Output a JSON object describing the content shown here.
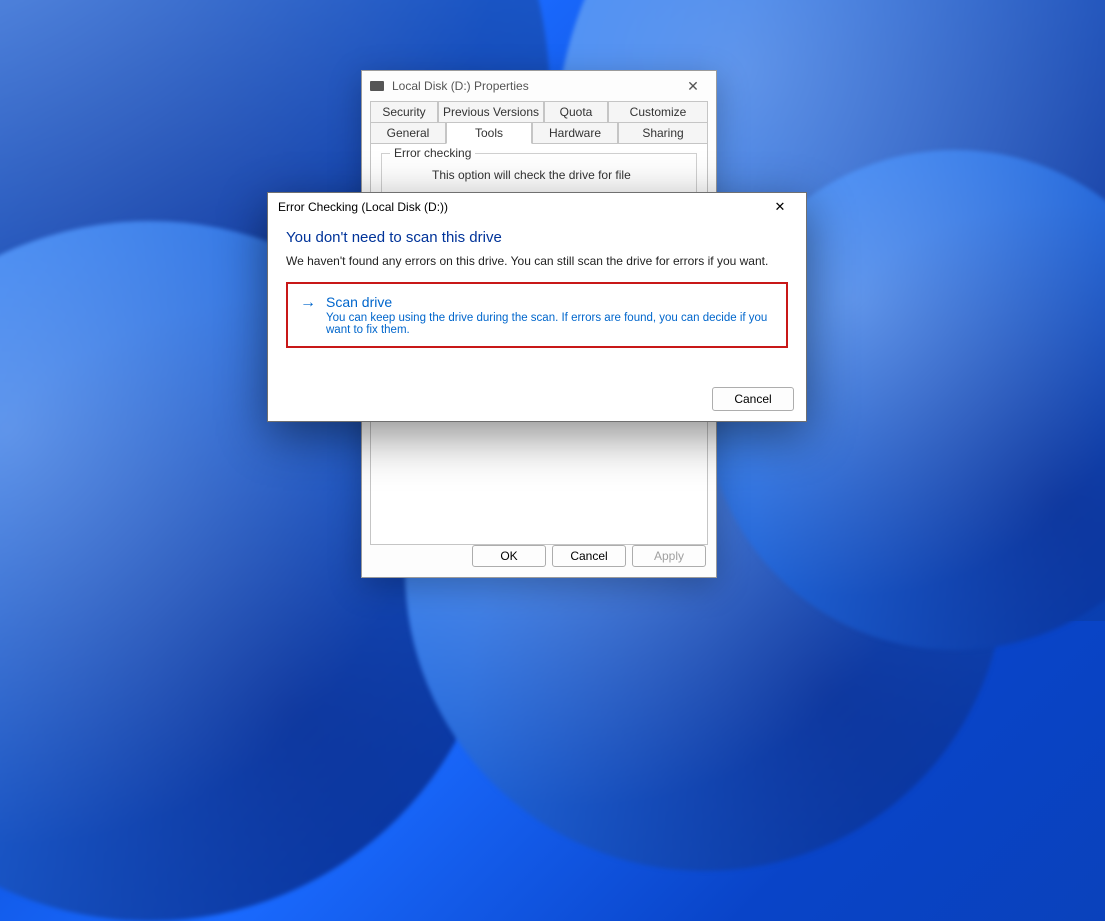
{
  "properties": {
    "title": "Local Disk (D:) Properties",
    "tabs_row1": {
      "security": "Security",
      "previous": "Previous Versions",
      "quota": "Quota",
      "customize": "Customize"
    },
    "tabs_row2": {
      "general": "General",
      "tools": "Tools",
      "hardware": "Hardware",
      "sharing": "Sharing"
    },
    "active_tab": "Tools",
    "group": {
      "label": "Error checking",
      "text": "This option will check the drive for file"
    },
    "buttons": {
      "ok": "OK",
      "cancel": "Cancel",
      "apply": "Apply"
    }
  },
  "error_dialog": {
    "title": "Error Checking (Local Disk (D:))",
    "headline": "You don't need to scan this drive",
    "subtext": "We haven't found any errors on this drive. You can still scan the drive for errors if you want.",
    "option": {
      "title": "Scan drive",
      "desc": "You can keep using the drive during the scan. If errors are found, you can decide if you want to fix them."
    },
    "cancel": "Cancel"
  }
}
